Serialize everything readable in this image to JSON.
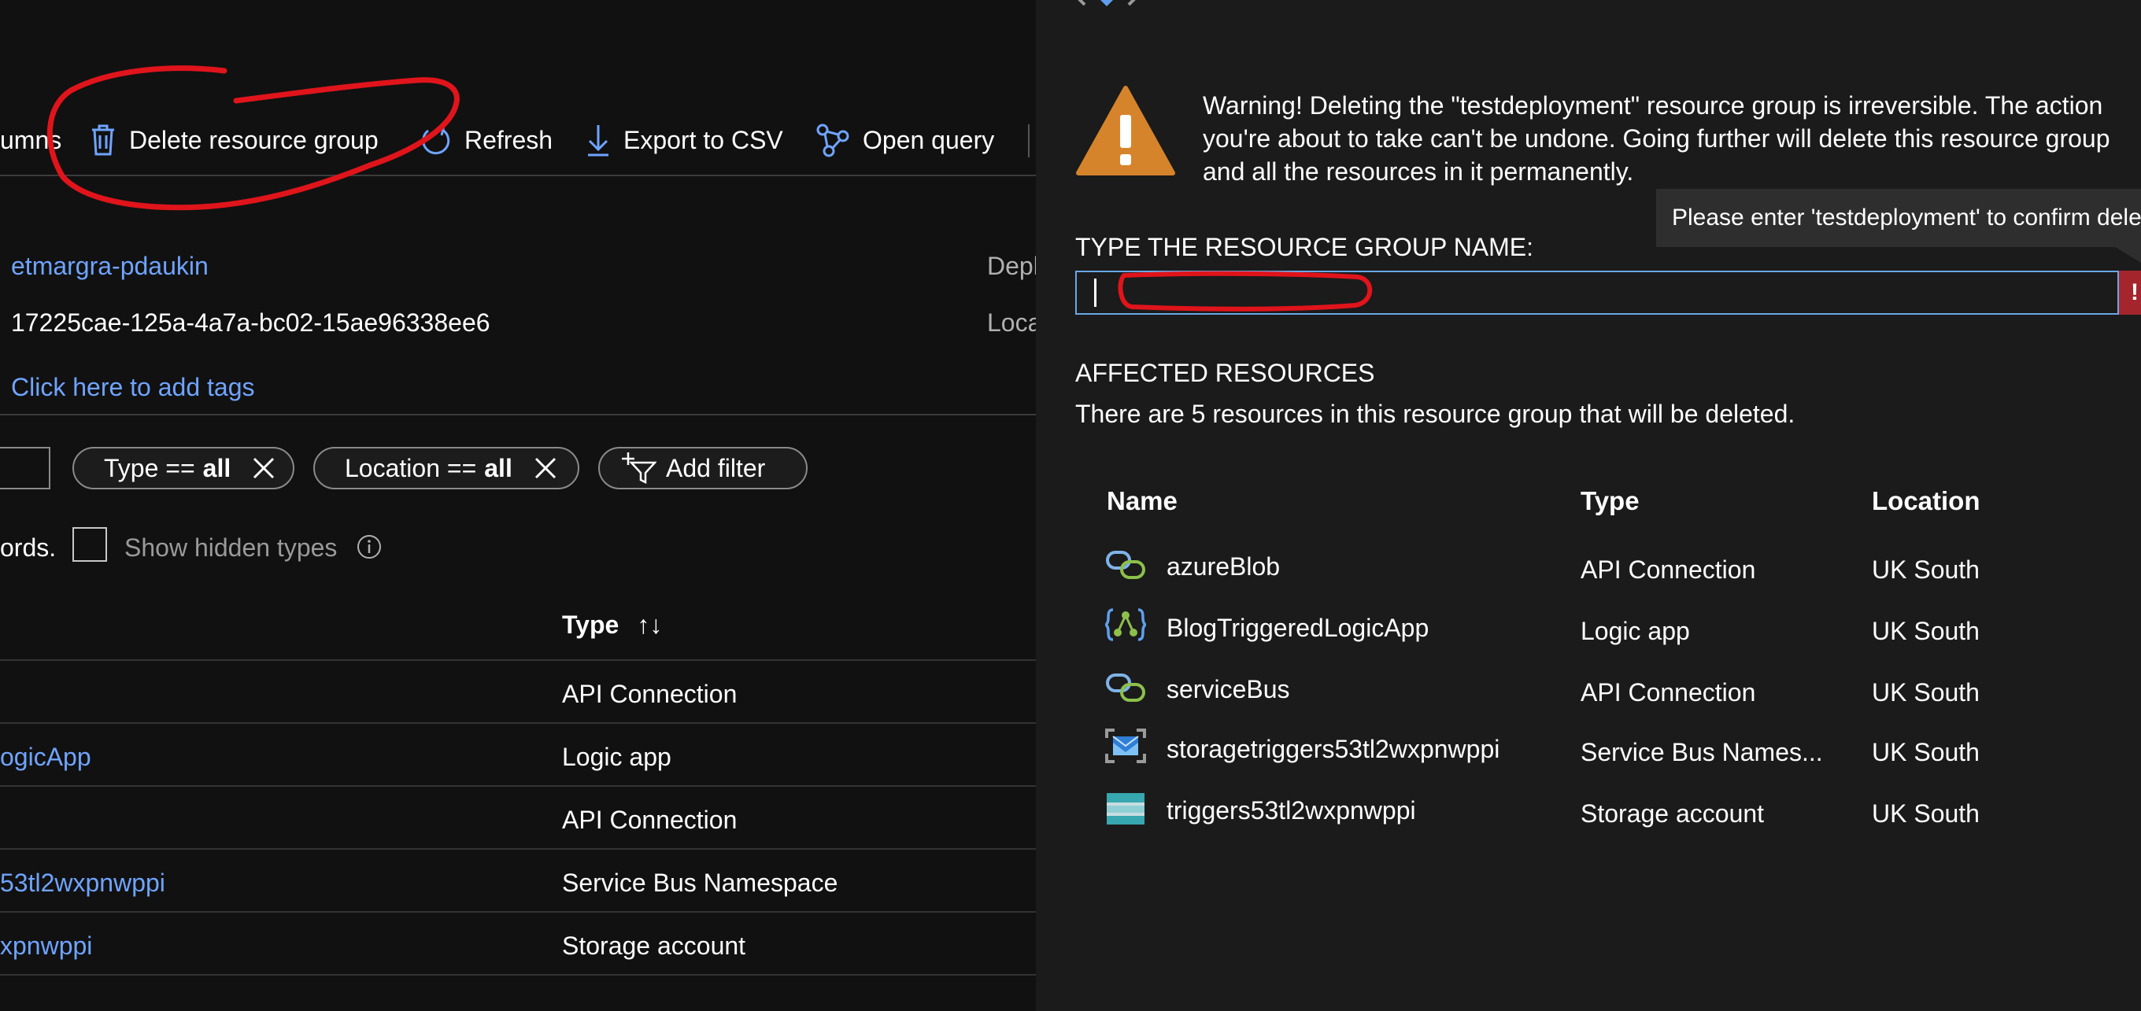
{
  "toolbar": {
    "columns_label": "umns",
    "delete_label": "Delete resource group",
    "refresh_label": "Refresh",
    "export_label": "Export to CSV",
    "query_label": "Open query"
  },
  "essentials": {
    "subscription_link": "etmargra-pdaukin",
    "subscription_id": "17225cae-125a-4a7a-bc02-15ae96338ee6",
    "tags_link": "Click here to add tags",
    "deployments_label": "Depl",
    "location_label": "Loca"
  },
  "filters": {
    "type_pill": {
      "key": "Type ==",
      "value": "all"
    },
    "location_pill": {
      "key": "Location ==",
      "value": "all"
    },
    "add_filter_label": "Add filter",
    "records_label": "ords.",
    "show_hidden_label": "Show hidden types"
  },
  "list": {
    "type_header": "Type",
    "sort_glyph": "↑↓",
    "rows": [
      {
        "name": "",
        "type": "API Connection"
      },
      {
        "name": "ogicApp",
        "type": "Logic app"
      },
      {
        "name": "",
        "type": "API Connection"
      },
      {
        "name": "53tl2wxpnwppi",
        "type": "Service Bus Namespace"
      },
      {
        "name": "xpnwppi",
        "type": "Storage account"
      }
    ]
  },
  "dialog": {
    "warning_line1": "Warning! Deleting the \"testdeployment\" resource group is irreversible. The action",
    "warning_line2": "you're about to take can't be undone. Going further will delete this resource group",
    "warning_line3": "and all the resources in it permanently.",
    "tooltip": "Please enter 'testdeployment' to confirm dele",
    "input_label": "TYPE THE RESOURCE GROUP NAME:",
    "input_value": "",
    "error_glyph": "!",
    "affected_title": "AFFECTED RESOURCES",
    "affected_desc": "There are 5 resources in this resource group that will be deleted.",
    "columns": {
      "name": "Name",
      "type": "Type",
      "location": "Location"
    },
    "resources": [
      {
        "icon": "api-connection-icon",
        "name": "azureBlob",
        "type": "API Connection",
        "location": "UK South"
      },
      {
        "icon": "logic-app-icon",
        "name": "BlogTriggeredLogicApp",
        "type": "Logic app",
        "location": "UK South"
      },
      {
        "icon": "api-connection-icon",
        "name": "serviceBus",
        "type": "API Connection",
        "location": "UK South"
      },
      {
        "icon": "service-bus-icon",
        "name": "storagetriggers53tl2wxpnwppi",
        "type": "Service Bus Names...",
        "location": "UK South"
      },
      {
        "icon": "storage-account-icon",
        "name": "triggers53tl2wxpnwppi",
        "type": "Storage account",
        "location": "UK South"
      }
    ]
  },
  "colors": {
    "link": "#6fa4ff",
    "warning": "#d6842b",
    "annotation": "#e0141b",
    "error": "#a4262c",
    "input_border": "#6aa7e6"
  }
}
